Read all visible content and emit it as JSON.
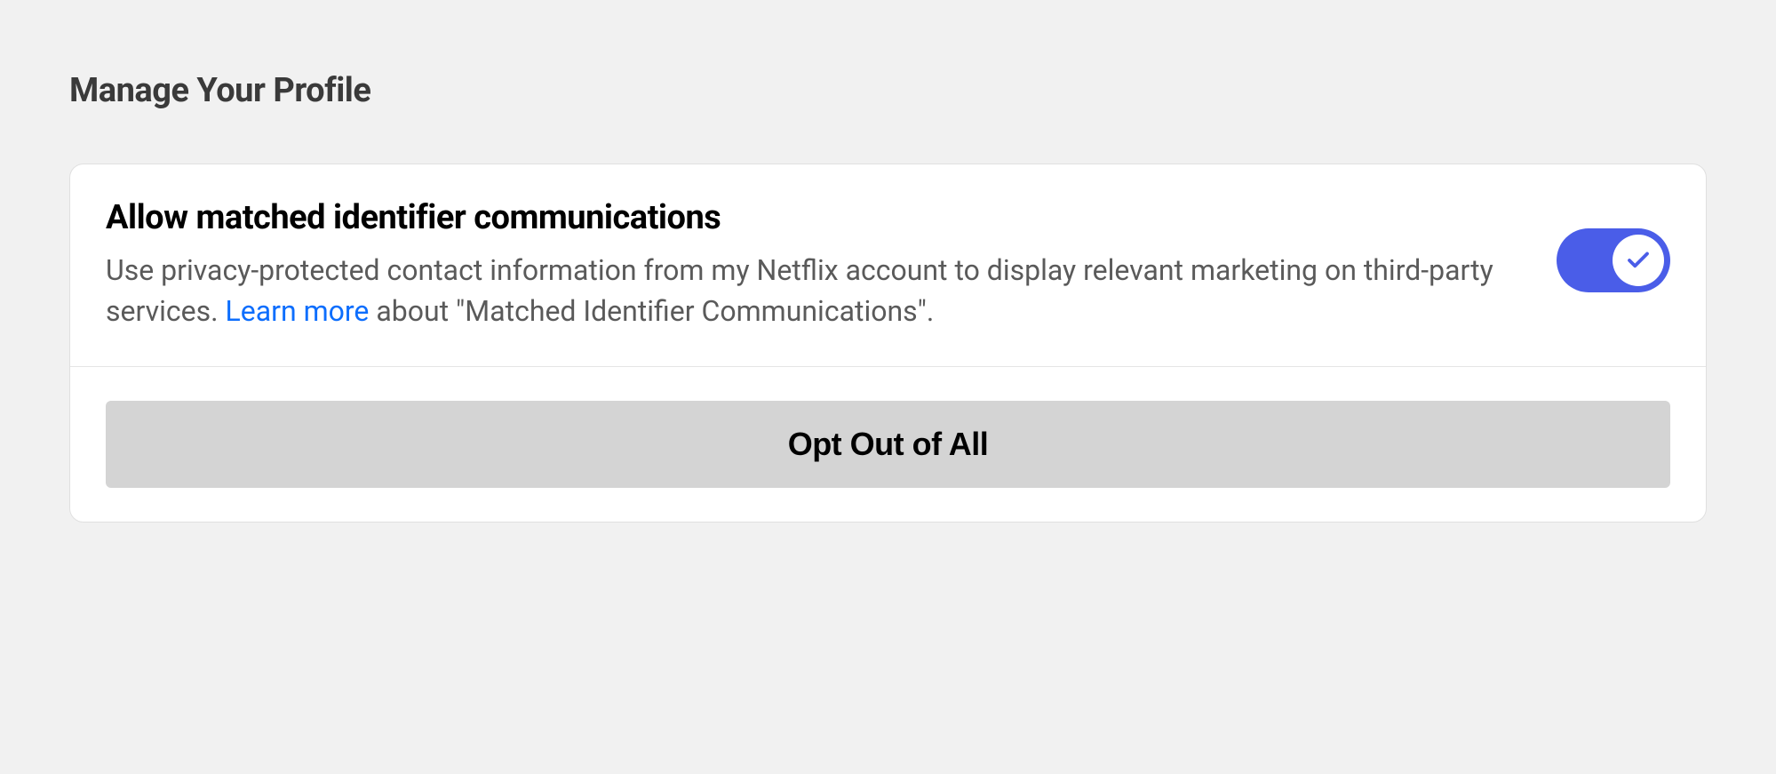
{
  "page": {
    "title": "Manage Your Profile"
  },
  "setting": {
    "heading": "Allow matched identifier communications",
    "description_before": "Use privacy-protected contact information from my Netflix account to display relevant marketing on third-party services. ",
    "learn_more": "Learn more",
    "description_after": " about \"Matched Identifier Communications\".",
    "toggle_on": true
  },
  "button": {
    "opt_out_label": "Opt Out of All"
  },
  "colors": {
    "toggle_active": "#4a5de8",
    "link": "#0d6efd",
    "button_bg": "#d4d4d4"
  }
}
